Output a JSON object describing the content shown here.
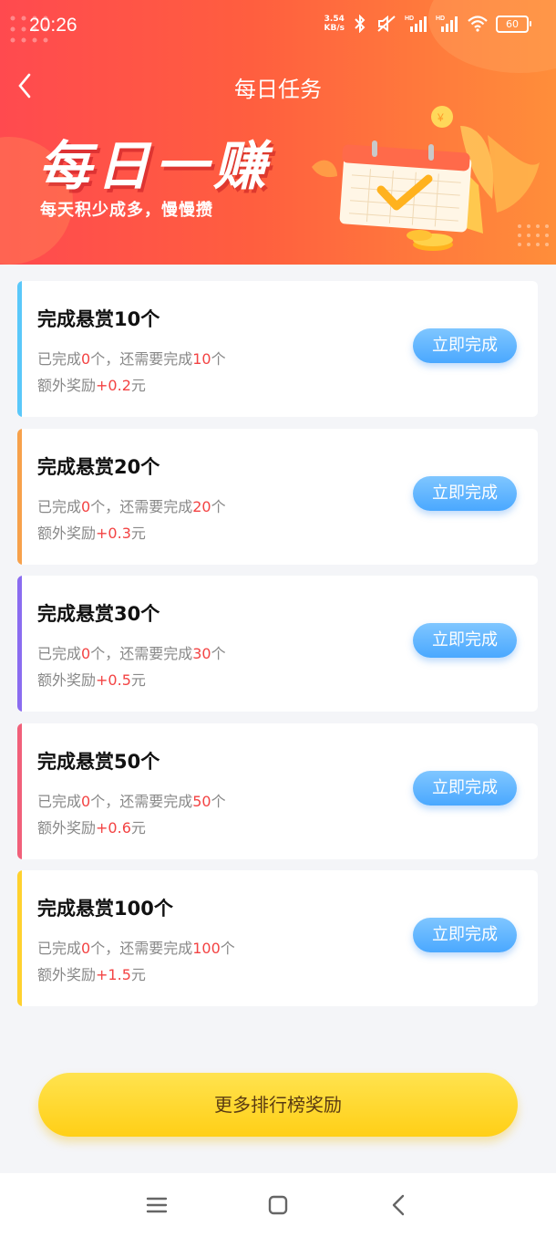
{
  "status_bar": {
    "time": "20:26",
    "net_speed_value": "3.54",
    "net_speed_unit": "KB/s",
    "battery": "60",
    "icons": [
      "bluetooth-icon",
      "mute-icon",
      "hd-signal-icon",
      "hd-signal-icon",
      "wifi-icon",
      "battery-icon"
    ]
  },
  "nav": {
    "title": "每日任务",
    "back_icon": "chevron-left-icon"
  },
  "banner": {
    "title": "每日一赚",
    "subtitle": "每天积少成多，慢慢攒"
  },
  "tasks": [
    {
      "title": "完成悬赏10个",
      "done_prefix": "已完成",
      "done_count": "0",
      "remain_text": "个，还需要完成",
      "remain_count": "10",
      "unit": "个",
      "reward_prefix": "额外奖励",
      "reward": "+0.2",
      "reward_unit": "元",
      "button": "立即完成",
      "accent": "#5ac8fa"
    },
    {
      "title": "完成悬赏20个",
      "done_prefix": "已完成",
      "done_count": "0",
      "remain_text": "个，还需要完成",
      "remain_count": "20",
      "unit": "个",
      "reward_prefix": "额外奖励",
      "reward": "+0.3",
      "reward_unit": "元",
      "button": "立即完成",
      "accent": "#f7a14b"
    },
    {
      "title": "完成悬赏30个",
      "done_prefix": "已完成",
      "done_count": "0",
      "remain_text": "个，还需要完成",
      "remain_count": "30",
      "unit": "个",
      "reward_prefix": "额外奖励",
      "reward": "+0.5",
      "reward_unit": "元",
      "button": "立即完成",
      "accent": "#8a6cf0"
    },
    {
      "title": "完成悬赏50个",
      "done_prefix": "已完成",
      "done_count": "0",
      "remain_text": "个，还需要完成",
      "remain_count": "50",
      "unit": "个",
      "reward_prefix": "额外奖励",
      "reward": "+0.6",
      "reward_unit": "元",
      "button": "立即完成",
      "accent": "#f1607a"
    },
    {
      "title": "完成悬赏100个",
      "done_prefix": "已完成",
      "done_count": "0",
      "remain_text": "个，还需要完成",
      "remain_count": "100",
      "unit": "个",
      "reward_prefix": "额外奖励",
      "reward": "+1.5",
      "reward_unit": "元",
      "button": "立即完成",
      "accent": "#ffd12e"
    }
  ],
  "more_button": "更多排行榜奖励",
  "system_nav": {
    "icons": [
      "menu-icon",
      "home-square-icon",
      "back-icon"
    ]
  }
}
